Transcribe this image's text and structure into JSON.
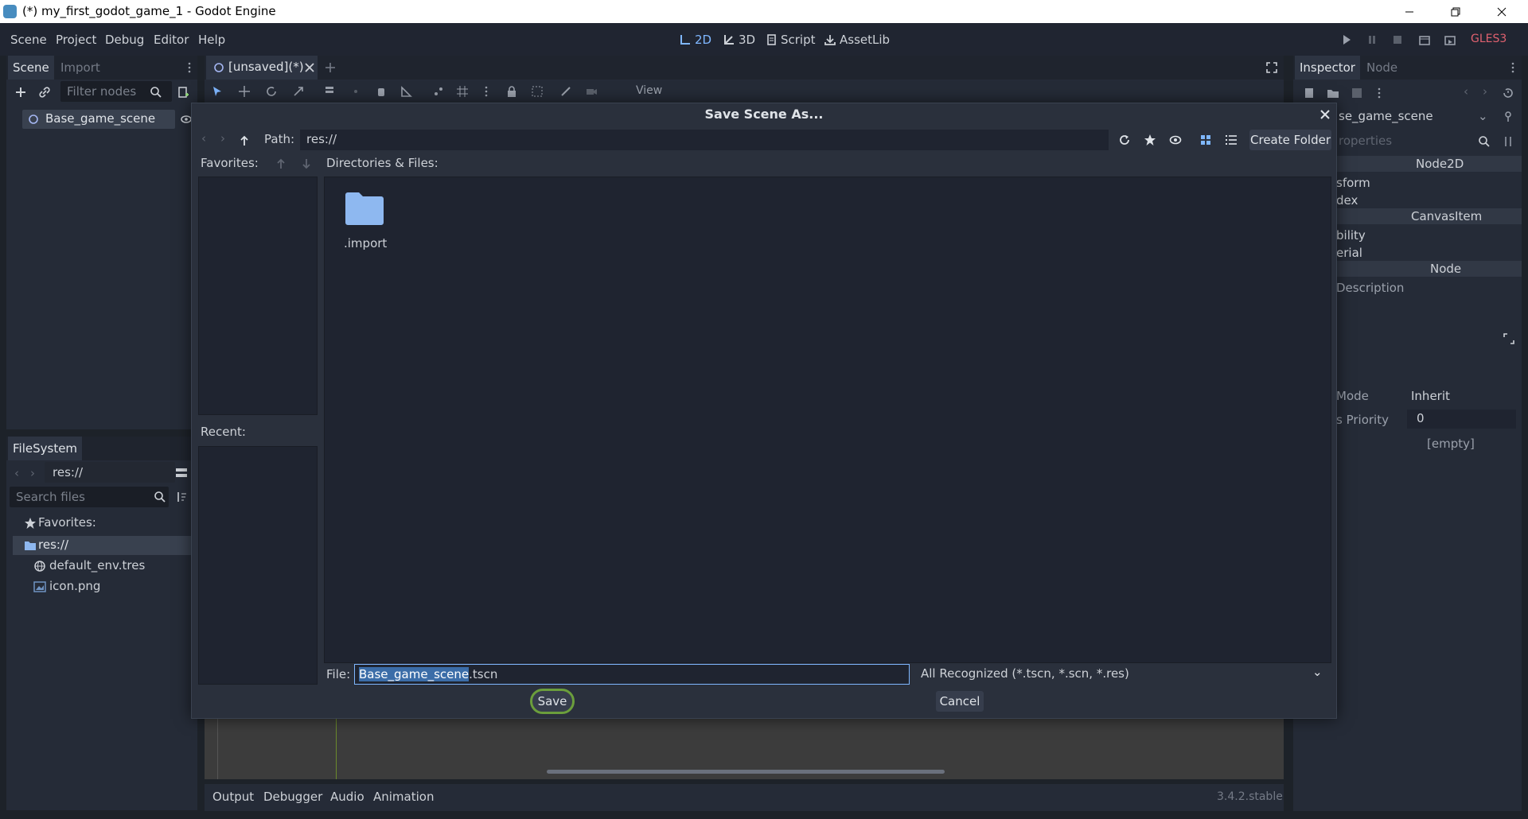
{
  "window": {
    "title": "(*) my_first_godot_game_1 - Godot Engine"
  },
  "menu": [
    "Scene",
    "Project",
    "Debug",
    "Editor",
    "Help"
  ],
  "workspaces": [
    {
      "label": "2D",
      "icon": "2d-icon",
      "active": true
    },
    {
      "label": "3D",
      "icon": "3d-icon",
      "active": false
    },
    {
      "label": "Script",
      "icon": "script-icon",
      "active": false
    },
    {
      "label": "AssetLib",
      "icon": "assetlib-icon",
      "active": false
    }
  ],
  "renderer": "GLES3",
  "scene_dock": {
    "tabs": [
      "Scene",
      "Import"
    ],
    "filter_placeholder": "Filter nodes",
    "root_node": "Base_game_scene"
  },
  "filesystem_dock": {
    "tab": "FileSystem",
    "path": "res://",
    "search_placeholder": "Search files",
    "favorites_label": "Favorites:",
    "tree": [
      "res://",
      "default_env.tres",
      "icon.png"
    ]
  },
  "editor_tabs": {
    "scene_tab": "[unsaved](*)",
    "view_menu": "View"
  },
  "bottom_panel": {
    "tabs": [
      "Output",
      "Debugger",
      "Audio",
      "Animation"
    ],
    "version": "3.4.2.stable"
  },
  "inspector": {
    "tabs": [
      "Inspector",
      "Node"
    ],
    "object_name": "se_game_scene",
    "filter_placeholder": "roperties",
    "sections": [
      "Node2D",
      "CanvasItem",
      "Node"
    ],
    "rows": [
      "sform",
      "dex",
      "bility",
      "erial",
      "Description"
    ],
    "mode_label": "Mode",
    "mode_value": "Inherit",
    "priority_label": "s Priority",
    "priority_value": "0",
    "empty_value": "[empty]"
  },
  "dialog": {
    "title": "Save Scene As...",
    "path_label": "Path:",
    "path_value": "res://",
    "create_folder": "Create Folder",
    "favorites_label": "Favorites:",
    "recent_label": "Recent:",
    "dir_label": "Directories & Files:",
    "items": [
      {
        "name": ".import",
        "type": "folder"
      }
    ],
    "file_label": "File:",
    "file_selected": "Base_game_scene",
    "file_ext": ".tscn",
    "filter_value": "All Recognized (*.tscn, *.scn, *.res)",
    "save_label": "Save",
    "cancel_label": "Cancel"
  },
  "colors": {
    "accent": "#7fb7ff",
    "folder": "#8eb8f0",
    "highlight": "#6b9e3c",
    "renderer": "#e0616f"
  }
}
